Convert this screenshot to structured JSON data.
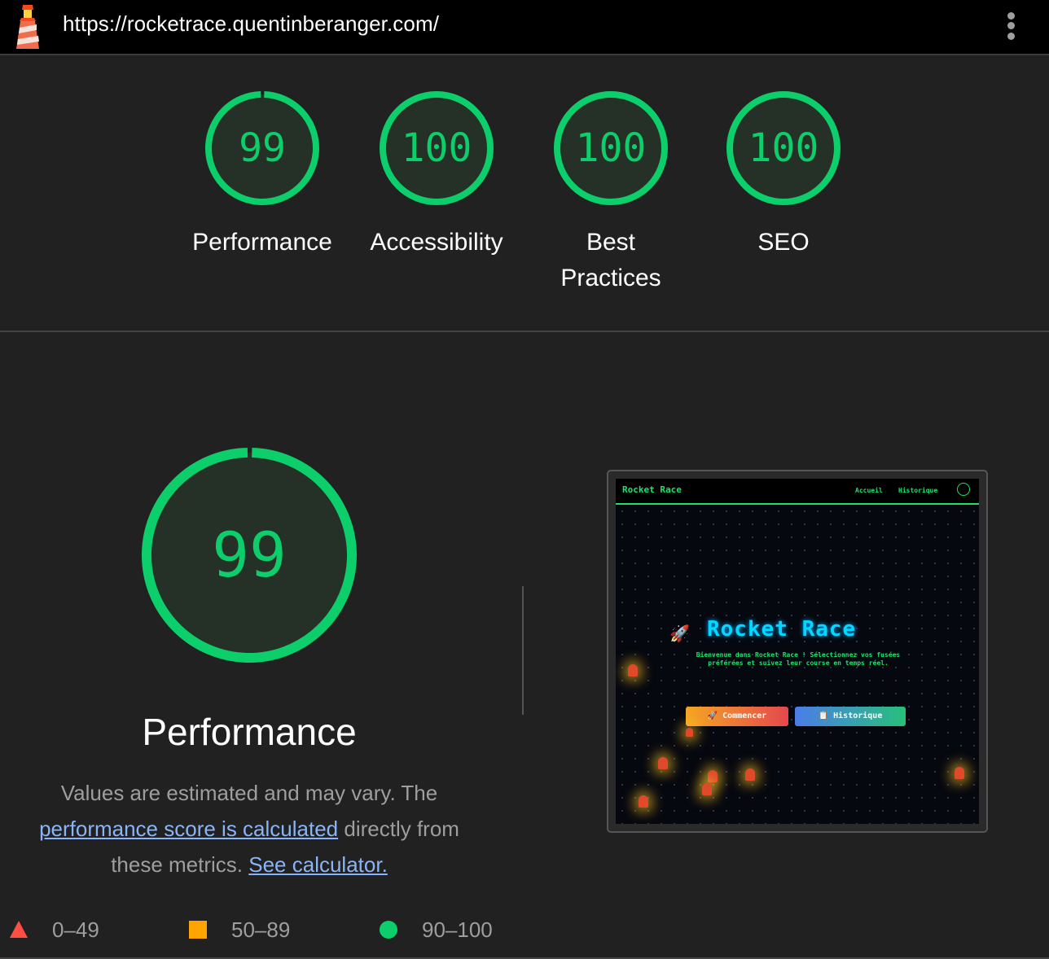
{
  "browser": {
    "url": "https://rocketrace.quentinberanger.com/",
    "logo_icon": "lighthouse-icon",
    "menu_icon": "more-vert-icon"
  },
  "scores": [
    {
      "value": 99,
      "label": "Performance"
    },
    {
      "value": 100,
      "label": "Accessibility"
    },
    {
      "value": 100,
      "label": "Best Practices"
    },
    {
      "value": 100,
      "label": "SEO"
    }
  ],
  "performance": {
    "score": 99,
    "title": "Performance",
    "desc_pre": "Values are estimated and may vary. The",
    "desc_link1": "performance score is calculated",
    "desc_mid": "directly from these metrics.",
    "desc_link2": "See calculator."
  },
  "legend": [
    {
      "range": "0–49",
      "shape": "triangle",
      "color": "#ff4e42"
    },
    {
      "range": "50–89",
      "shape": "square",
      "color": "#ffa400"
    },
    {
      "range": "90–100",
      "shape": "circle",
      "color": "#0cce6b"
    }
  ],
  "thumbnail": {
    "brand": "Rocket Race",
    "nav_home": "Accueil",
    "nav_history": "Historique",
    "hero_title": "Rocket Race",
    "hero_text": "Bienvenue dans Rocket Race ! Sélectionnez vos fusées préférées et suivez leur course en temps réel.",
    "btn_start": "🚀 Commencer",
    "btn_history": "📋 Historique"
  },
  "colors": {
    "pass": "#0cce6b",
    "pass_fill": "#253026",
    "link": "#8ab4f8",
    "background": "#212121"
  }
}
